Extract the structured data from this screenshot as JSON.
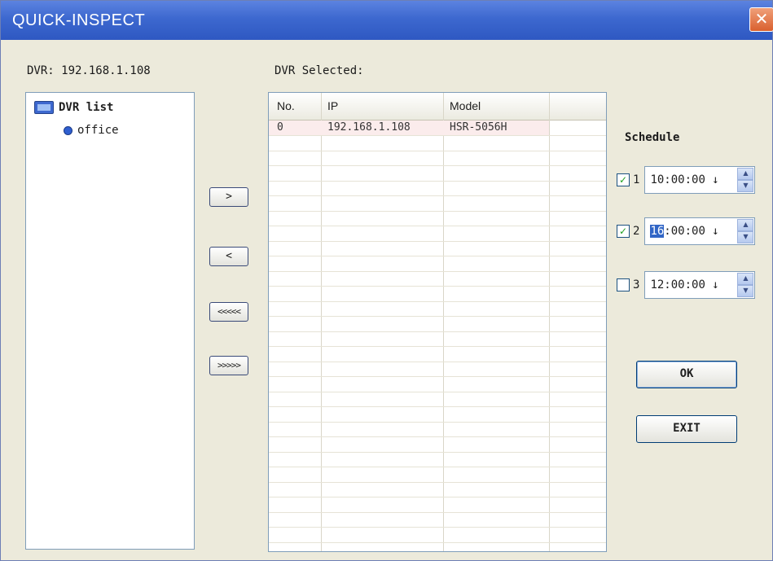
{
  "window": {
    "title": "QUICK-INSPECT",
    "close_glyph": "✕"
  },
  "dvr_label": "DVR: 192.168.1.108",
  "selected_label": "DVR Selected:",
  "tree": {
    "root_label": "DVR list",
    "root_icon": "dvr-icon",
    "children": [
      {
        "label": "office",
        "icon": "dot-icon"
      }
    ]
  },
  "transfer_buttons": {
    "add": ">",
    "remove": "<",
    "remove_all": "<<<<<",
    "add_all": ">>>>>"
  },
  "table": {
    "columns": [
      "No.",
      "IP",
      "Model"
    ],
    "rows": [
      {
        "no": "0",
        "ip": "192.168.1.108",
        "model": "HSR-5056H"
      }
    ]
  },
  "schedule": {
    "label": "Schedule",
    "items": [
      {
        "index": "1",
        "checked": true,
        "hh": "10",
        "rest": ":00:00 ↓"
      },
      {
        "index": "2",
        "checked": true,
        "hh": "16",
        "rest": ":00:00 ↓",
        "hh_selected": true
      },
      {
        "index": "3",
        "checked": false,
        "hh": "12",
        "rest": ":00:00 ↓"
      }
    ],
    "check_glyph": "✓",
    "spin_up": "▲",
    "spin_down": "▼"
  },
  "buttons": {
    "ok": "OK",
    "exit": "EXIT"
  },
  "colors": {
    "titlebar": "#3d68cf",
    "selected_row": "#fbecec",
    "selection": "#3166c6",
    "check": "#21a121"
  }
}
